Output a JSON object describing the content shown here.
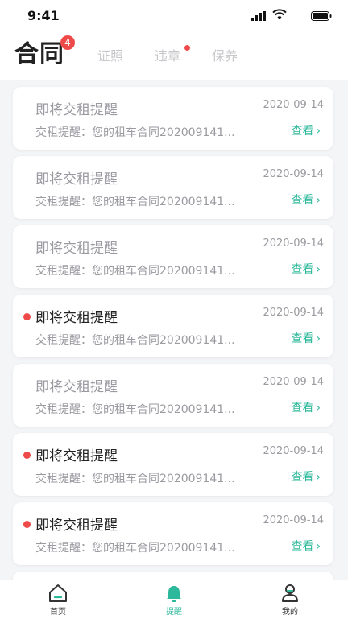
{
  "status_bar": {
    "time": "9:41"
  },
  "header": {
    "active_tab": "合同",
    "badge": "4",
    "tabs": [
      {
        "label": "证照",
        "dot": false
      },
      {
        "label": "违章",
        "dot": true
      },
      {
        "label": "保养",
        "dot": false
      }
    ]
  },
  "cards": [
    {
      "title": "即将交租提醒",
      "date": "2020-09-14",
      "message": "交租提醒：您的租车合同202009141...",
      "action": "查看",
      "unread": false
    },
    {
      "title": "即将交租提醒",
      "date": "2020-09-14",
      "message": "交租提醒：您的租车合同202009141...",
      "action": "查看",
      "unread": false
    },
    {
      "title": "即将交租提醒",
      "date": "2020-09-14",
      "message": "交租提醒：您的租车合同202009141...",
      "action": "查看",
      "unread": false
    },
    {
      "title": "即将交租提醒",
      "date": "2020-09-14",
      "message": "交租提醒：您的租车合同202009141...",
      "action": "查看",
      "unread": true
    },
    {
      "title": "即将交租提醒",
      "date": "2020-09-14",
      "message": "交租提醒：您的租车合同202009141...",
      "action": "查看",
      "unread": false
    },
    {
      "title": "即将交租提醒",
      "date": "2020-09-14",
      "message": "交租提醒：您的租车合同202009141...",
      "action": "查看",
      "unread": true
    },
    {
      "title": "即将交租提醒",
      "date": "2020-09-14",
      "message": "交租提醒：您的租车合同202009141...",
      "action": "查看",
      "unread": true
    }
  ],
  "tabbar": [
    {
      "label": "首页",
      "icon": "home-icon",
      "active": false
    },
    {
      "label": "提醒",
      "icon": "bell-icon",
      "active": true
    },
    {
      "label": "我的",
      "icon": "profile-icon",
      "active": false
    }
  ],
  "colors": {
    "accent": "#2cb89b",
    "alert": "#ef4a4a"
  }
}
